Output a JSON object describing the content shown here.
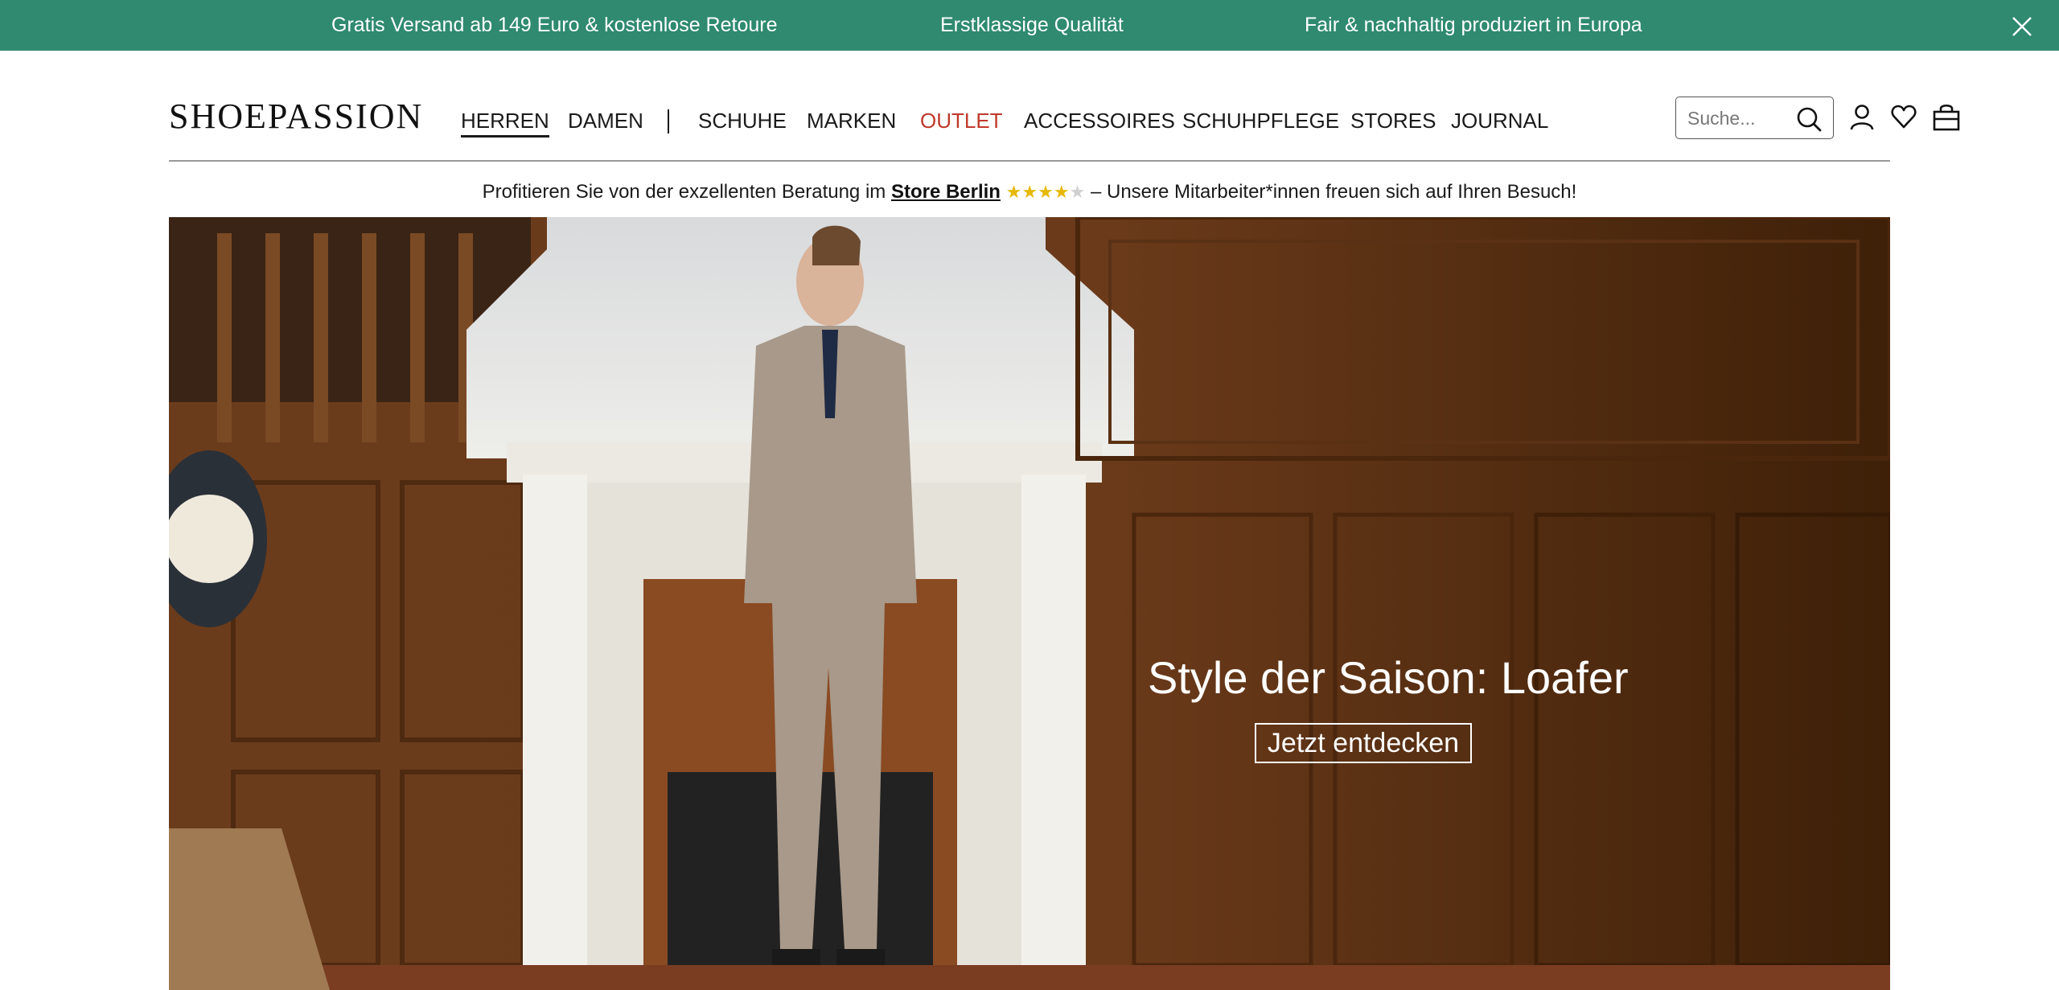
{
  "promo": {
    "items": [
      "Gratis Versand ab 149 Euro & kostenlose Retoure",
      "Erstklassige Qualität",
      "Fair & nachhaltig produziert in Europa"
    ],
    "background": "#2f8a6f"
  },
  "logo": "SHOEPASSION",
  "nav": {
    "items": [
      "HERREN",
      "DAMEN",
      "SCHUHE",
      "MARKEN",
      "OUTLET",
      "ACCESSOIRES",
      "SCHUHPFLEGE",
      "STORES",
      "JOURNAL"
    ],
    "active": "HERREN",
    "highlight_color": "#c0392b"
  },
  "search": {
    "placeholder": "Suche..."
  },
  "icons": [
    "search-icon",
    "user-icon",
    "heart-icon",
    "bag-icon",
    "close-icon"
  ],
  "store_banner": {
    "prefix": "Profitieren Sie von der exzellenten Beratung im",
    "link": "Store Berlin",
    "rating": 4,
    "rating_max": 5,
    "suffix": "– Unsere Mitarbeiter*innen freuen sich auf Ihren Besuch!"
  },
  "hero": {
    "title": "Style der Saison: Loafer",
    "cta": "Jetzt entdecken"
  }
}
